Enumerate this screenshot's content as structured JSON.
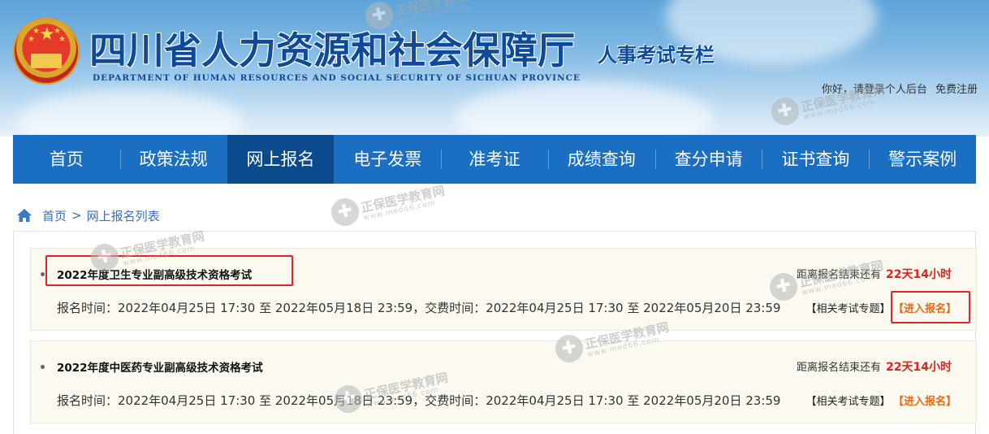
{
  "header": {
    "title": "四川省人力资源和社会保障厅",
    "subtitle_en": "DEPARTMENT OF HUMAN RESOURCES AND SOCIAL SECURITY OF SICHUAN PROVINCE",
    "column": "人事考试专栏",
    "greeting": "你好，请登录个人后台",
    "register": "免费注册"
  },
  "nav": {
    "items": [
      "首页",
      "政策法规",
      "网上报名",
      "电子发票",
      "准考证",
      "成绩查询",
      "查分申请",
      "证书查询",
      "警示案例"
    ],
    "active_index": 2
  },
  "breadcrumb": {
    "home": "首页",
    "separator": ">",
    "current": "网上报名列表"
  },
  "exams": [
    {
      "title": "2022年度卫生专业副高级技术资格考试",
      "countdown_label": "距离报名结束还有",
      "countdown_value": "22天14小时",
      "times": "报名时间：2022年04月25日 17:30 至 2022年05月18日 23:59，交费时间：2022年04月25日 17:30 至 2022年05月20日 23:59",
      "topic_link": "【相关考试专题】",
      "signup_link": "【进入报名】"
    },
    {
      "title": "2022年度中医药专业副高级技术资格考试",
      "countdown_label": "距离报名结束还有",
      "countdown_value": "22天14小时",
      "times": "报名时间：2022年04月25日 17:30 至 2022年05月18日 23:59，交费时间：2022年04月25日 17:30 至 2022年05月20日 23:59",
      "topic_link": "【相关考试专题】",
      "signup_link": "【进入报名】"
    }
  ],
  "watermark": {
    "name": "正保医学教育网",
    "url": "www.med66.com"
  },
  "colors": {
    "nav_bg": "#1a6fc2",
    "nav_active": "#0b4a8d",
    "title_blue": "#0d4a9a",
    "countdown_red": "#e2231a",
    "signup_orange": "#ea6a0e",
    "highlight_red": "#e32420"
  }
}
